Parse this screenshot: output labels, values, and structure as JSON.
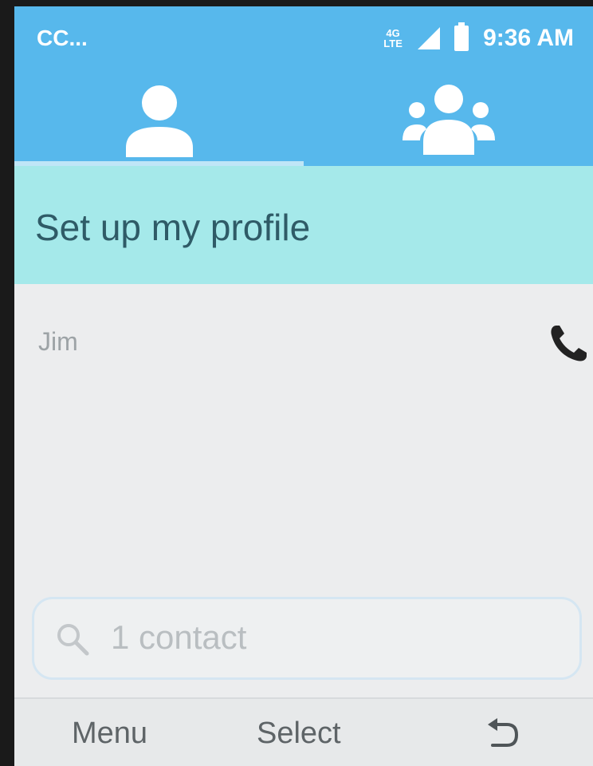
{
  "status_bar": {
    "carrier": "CC...",
    "network_badge": "4G\nLTE",
    "time": "9:36 AM"
  },
  "tabs": [
    {
      "name": "contacts",
      "icon": "person-icon",
      "selected": true
    },
    {
      "name": "groups",
      "icon": "group-icon",
      "selected": false
    }
  ],
  "profile": {
    "label": "Set up my profile"
  },
  "contacts": [
    {
      "name": "Jim",
      "icon": "phone-icon"
    }
  ],
  "search": {
    "text": "1 contact",
    "icon": "search-icon"
  },
  "softkeys": {
    "left": "Menu",
    "center": "Select",
    "right_icon": "back-icon"
  },
  "colors": {
    "header": "#57b8ec",
    "profile_row": "#a5e9ea",
    "background": "#ecedee"
  }
}
